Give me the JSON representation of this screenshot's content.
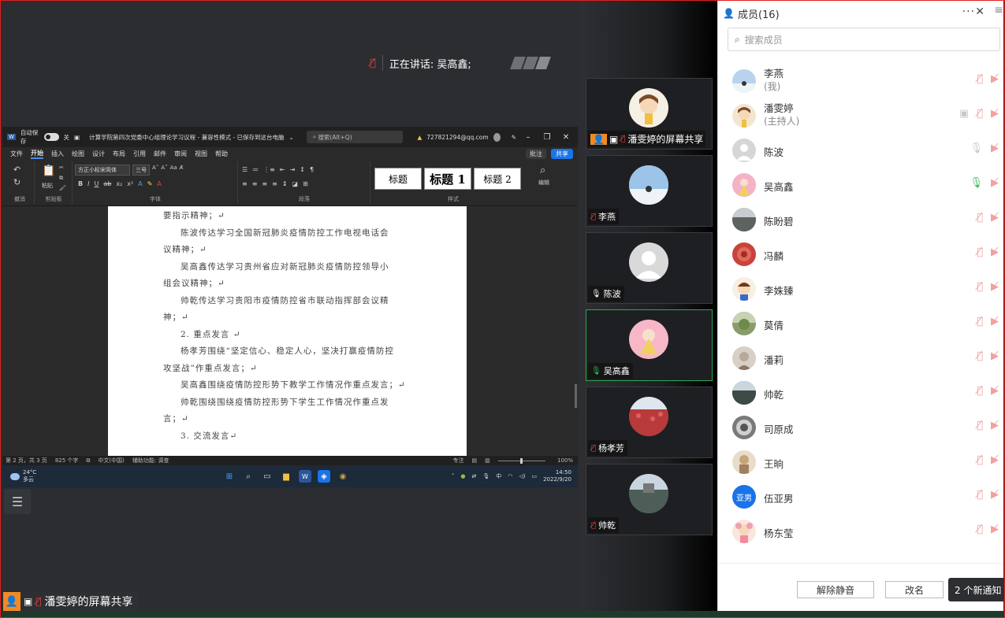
{
  "speaker": {
    "label": "正在讲话: 吴高鑫;"
  },
  "word": {
    "autosave": "自动保存",
    "autosave_state": "关",
    "title": "计算学院第四次党委中心组理论学习议程 - 兼容性模式 - 已保存到这台电脑",
    "search": "搜索(Alt+Q)",
    "account": "727821294@qq.com",
    "menu": [
      "文件",
      "开始",
      "插入",
      "绘图",
      "设计",
      "布局",
      "引用",
      "邮件",
      "审阅",
      "视图",
      "帮助"
    ],
    "comment_btn": "批注",
    "share_btn": "共享",
    "groups": {
      "undo": "撤消",
      "clipboard": "剪贴板",
      "font": "字体",
      "paragraph": "段落",
      "styles": "样式",
      "paste": "粘贴",
      "edit": "编辑"
    },
    "font_name": "方正小标宋简体",
    "font_size": "三号",
    "styles": [
      "标题",
      "标题 1",
      "标题 2"
    ],
    "doc_lines": [
      "要指示精神；↵",
      "陈波传达学习全国新冠肺炎疫情防控工作电视电话会",
      "议精神；↵",
      "吴高鑫传达学习贵州省应对新冠肺炎疫情防控领导小",
      "组会议精神；↵",
      "帅乾传达学习贵阳市疫情防控省市联动指挥部会议精",
      "神；↵",
      "2. 重点发言 ↵",
      "杨孝芳围绕“坚定信心、稳定人心，坚决打赢疫情防控",
      "攻坚战”作重点发言；↵",
      "吴高鑫围绕疫情防控形势下教学工作情况作重点发言；↵",
      "帅乾围绕围绕疫情防控形势下学生工作情况作重点发",
      "言；↵",
      "3. 交流发言↵"
    ],
    "status": {
      "page": "第 2 页，共 3 页",
      "words": "825 个字",
      "lang": "中文(中国)",
      "access": "辅助功能: 调查",
      "focus": "专注",
      "zoom": "100%"
    }
  },
  "taskbar": {
    "temp": "24°C",
    "weather": "多云",
    "ime": "中",
    "time": "14:50",
    "date": "2022/9/20"
  },
  "share_label": "潘雯婷的屏幕共享",
  "tiles": [
    {
      "name": "潘雯婷的屏幕共享",
      "mic": "muted",
      "color": "#f5efe4"
    },
    {
      "name": "李燕",
      "mic": "muted",
      "color": "#cfe0f2"
    },
    {
      "name": "陈波",
      "mic": "on",
      "color": "#d9d9d9"
    },
    {
      "name": "吴高鑫",
      "mic": "on",
      "color": "#f7b7c6"
    },
    {
      "name": "杨孝芳",
      "mic": "muted",
      "color": "#b83a3a"
    },
    {
      "name": "帅乾",
      "mic": "muted",
      "color": "#6a7f7a"
    }
  ],
  "panel": {
    "title": "成员(16)",
    "search_placeholder": "搜索成员",
    "members": [
      {
        "name": "李燕",
        "sub": "(我)",
        "mic": "muted",
        "color": "#b9d3ef",
        "screen": false
      },
      {
        "name": "潘雯婷",
        "sub": "(主持人)",
        "mic": "muted",
        "color": "#f3e6cf",
        "screen": true
      },
      {
        "name": "陈波",
        "sub": "",
        "mic": "idle",
        "color": "#d6d6d6",
        "screen": false
      },
      {
        "name": "吴高鑫",
        "sub": "",
        "mic": "speaking",
        "color": "#f4b3c4",
        "screen": false
      },
      {
        "name": "陈盼碧",
        "sub": "",
        "mic": "muted",
        "color": "#8a8f88",
        "screen": false
      },
      {
        "name": "冯麟",
        "sub": "",
        "mic": "muted",
        "color": "#c7433c",
        "screen": false
      },
      {
        "name": "李姝臻",
        "sub": "",
        "mic": "muted",
        "color": "#e8c9a0",
        "screen": false
      },
      {
        "name": "莫倩",
        "sub": "",
        "mic": "muted",
        "color": "#8b9c6a",
        "screen": false
      },
      {
        "name": "潘莉",
        "sub": "",
        "mic": "muted",
        "color": "#b9a89a",
        "screen": false
      },
      {
        "name": "帅乾",
        "sub": "",
        "mic": "muted",
        "color": "#5d6b66",
        "screen": false
      },
      {
        "name": "司原成",
        "sub": "",
        "mic": "muted",
        "color": "#7a7a7a",
        "screen": false
      },
      {
        "name": "王晌",
        "sub": "",
        "mic": "muted",
        "color": "#c7b8a0",
        "screen": false
      },
      {
        "name": "伍亚男",
        "sub": "",
        "mic": "muted",
        "color": "#1a73e8",
        "screen": false,
        "initials": "亚男"
      },
      {
        "name": "杨东莹",
        "sub": "",
        "mic": "muted",
        "color": "#f5d0c0",
        "screen": false
      }
    ],
    "unmute_btn": "解除静音",
    "rename_btn": "改名",
    "notice": "2 个新通知"
  },
  "colors": {
    "border": "#e02020",
    "accent": "#1a73e8",
    "speaking": "#3bbf5a",
    "muted": "#f2a0a0"
  }
}
